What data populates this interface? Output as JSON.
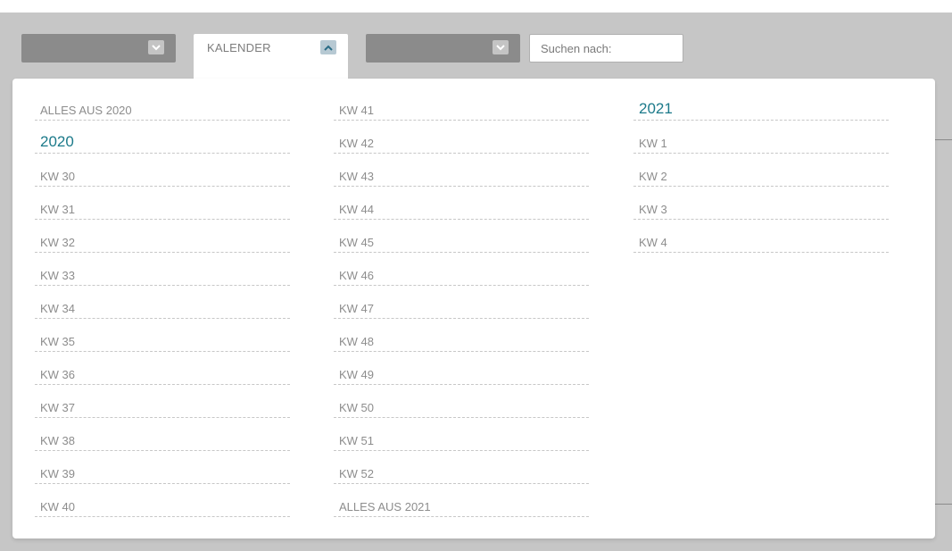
{
  "filters": {
    "dropdown1": {
      "label": ""
    },
    "calendar": {
      "label": "KALENDER"
    },
    "dropdown3": {
      "label": ""
    },
    "search": {
      "placeholder": "Suchen nach:",
      "value": ""
    }
  },
  "calendar_menu": {
    "columns": [
      {
        "items": [
          {
            "label": "ALLES AUS 2020",
            "kind": "all"
          },
          {
            "label": "2020",
            "kind": "year"
          },
          {
            "label": "KW 30",
            "kind": "week"
          },
          {
            "label": "KW 31",
            "kind": "week"
          },
          {
            "label": "KW 32",
            "kind": "week"
          },
          {
            "label": "KW 33",
            "kind": "week"
          },
          {
            "label": "KW 34",
            "kind": "week"
          },
          {
            "label": "KW 35",
            "kind": "week"
          },
          {
            "label": "KW 36",
            "kind": "week"
          },
          {
            "label": "KW 37",
            "kind": "week"
          },
          {
            "label": "KW 38",
            "kind": "week"
          },
          {
            "label": "KW 39",
            "kind": "week"
          },
          {
            "label": "KW 40",
            "kind": "week"
          }
        ]
      },
      {
        "items": [
          {
            "label": "KW 41",
            "kind": "week"
          },
          {
            "label": "KW 42",
            "kind": "week"
          },
          {
            "label": "KW 43",
            "kind": "week"
          },
          {
            "label": "KW 44",
            "kind": "week"
          },
          {
            "label": "KW 45",
            "kind": "week"
          },
          {
            "label": "KW 46",
            "kind": "week"
          },
          {
            "label": "KW 47",
            "kind": "week"
          },
          {
            "label": "KW 48",
            "kind": "week"
          },
          {
            "label": "KW 49",
            "kind": "week"
          },
          {
            "label": "KW 50",
            "kind": "week"
          },
          {
            "label": "KW 51",
            "kind": "week"
          },
          {
            "label": "KW 52",
            "kind": "week"
          },
          {
            "label": "ALLES AUS 2021",
            "kind": "all"
          }
        ]
      },
      {
        "items": [
          {
            "label": "2021",
            "kind": "year"
          },
          {
            "label": "KW 1",
            "kind": "week"
          },
          {
            "label": "KW 2",
            "kind": "week"
          },
          {
            "label": "KW 3",
            "kind": "week"
          },
          {
            "label": "KW 4",
            "kind": "week"
          }
        ]
      }
    ]
  },
  "colors": {
    "backdrop": "#c6c6c6",
    "dropdown": "#8b8b8b",
    "year_accent": "#1c7a8a",
    "item_text": "#8d8d8d"
  },
  "icons": {
    "dropdown_closed": "chevron-down-icon",
    "dropdown_open": "chevron-up-icon"
  }
}
